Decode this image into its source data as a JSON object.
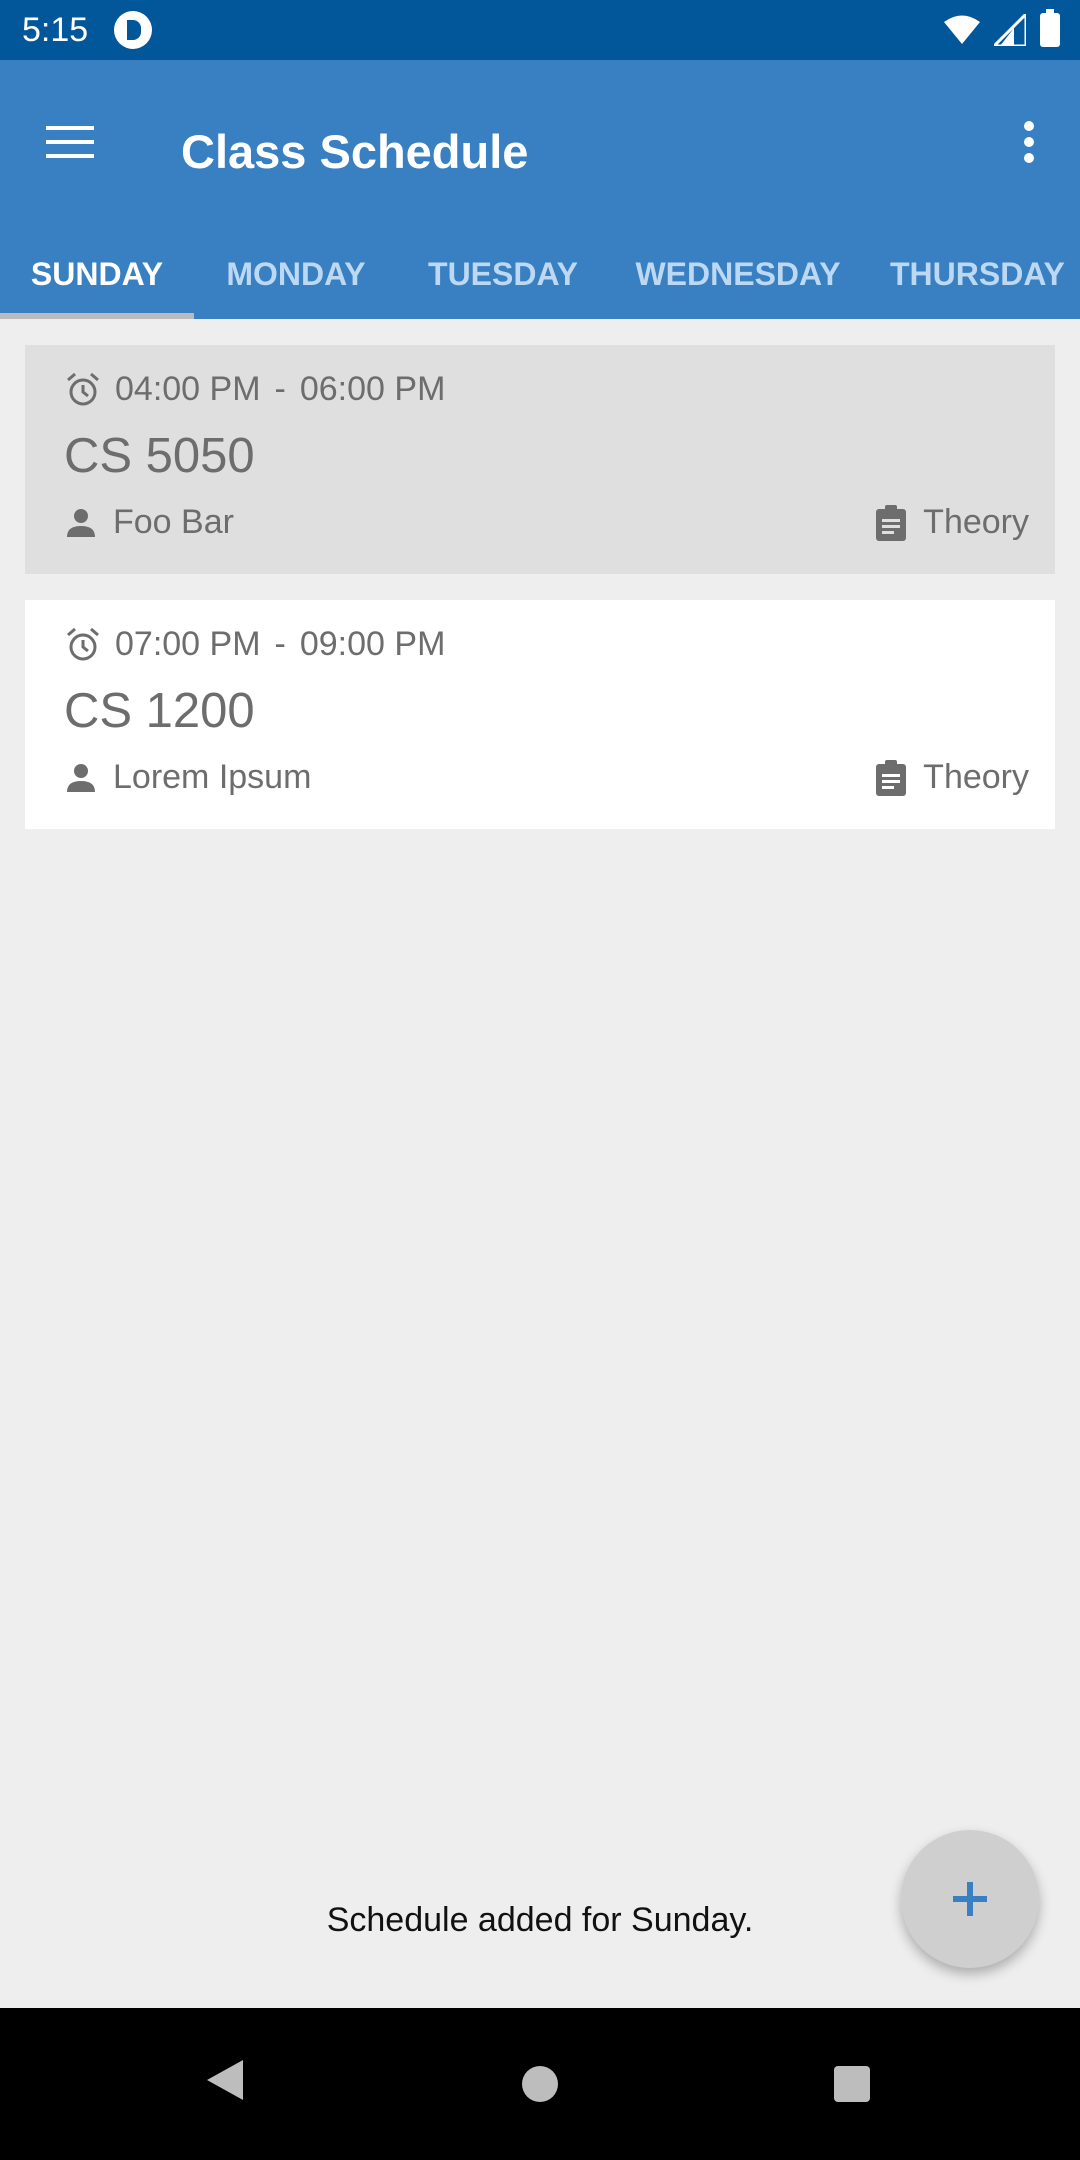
{
  "status_bar": {
    "time": "5:15"
  },
  "app_bar": {
    "title": "Class Schedule"
  },
  "tabs": [
    {
      "label": "SUNDAY",
      "active": true
    },
    {
      "label": "MONDAY",
      "active": false
    },
    {
      "label": "TUESDAY",
      "active": false
    },
    {
      "label": "WEDNESDAY",
      "active": false
    },
    {
      "label": "THURSDAY",
      "active": false
    }
  ],
  "classes": [
    {
      "start_time": "04:00 PM",
      "separator": "-",
      "end_time": "06:00 PM",
      "code": "CS 5050",
      "instructor": "Foo Bar",
      "type": "Theory"
    },
    {
      "start_time": "07:00 PM",
      "separator": "-",
      "end_time": "09:00 PM",
      "code": "CS 1200",
      "instructor": "Lorem Ipsum",
      "type": "Theory"
    }
  ],
  "snackbar": {
    "message": "Schedule added for Sunday."
  },
  "colors": {
    "status_bar": "#02579b",
    "primary": "#3880c1",
    "background": "#eeeeee",
    "fab": "#cfcfcf",
    "fab_icon": "#3880c1"
  },
  "icons": {
    "menu": "hamburger-menu-icon",
    "overflow": "more-vert-icon",
    "time": "alarm-icon",
    "instructor": "person-icon",
    "type": "clipboard-icon",
    "fab": "plus-icon"
  }
}
